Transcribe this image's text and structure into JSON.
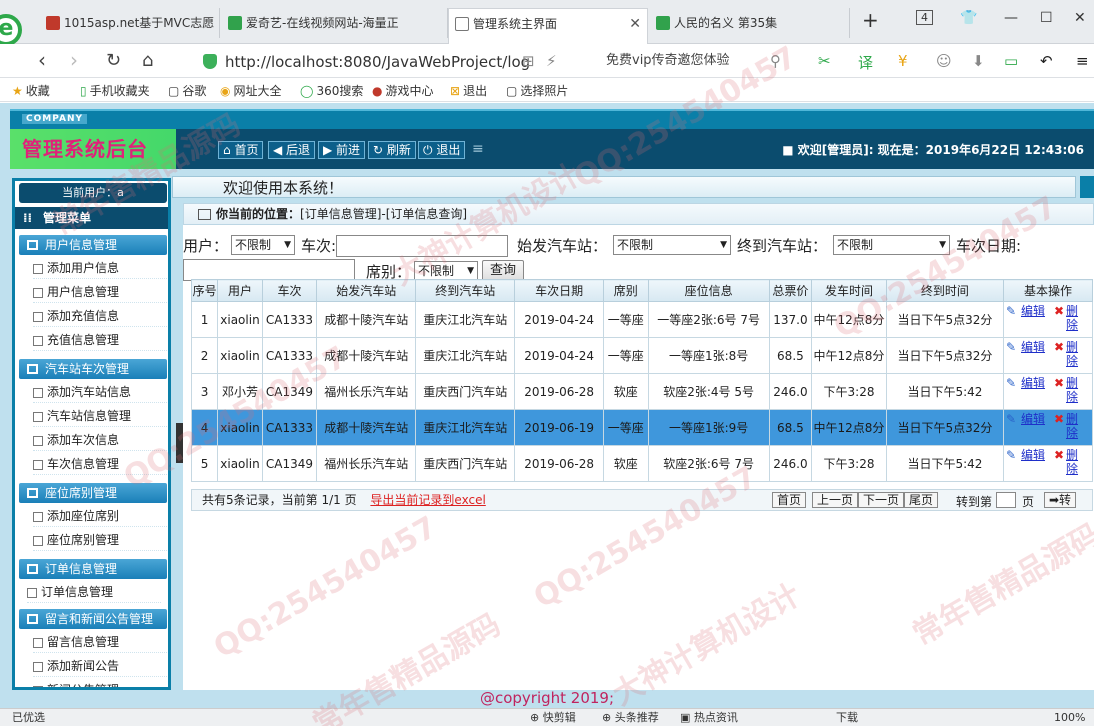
{
  "browser": {
    "tabs": [
      {
        "title": "1015asp.net基于MVC志愿"
      },
      {
        "title": "爱奇艺-在线视频网站-海量正"
      },
      {
        "title": "管理系统主界面"
      },
      {
        "title": "人民的名义 第35集"
      }
    ],
    "tab_count": "4",
    "url": "http://localhost:8080/JavaWebProject/log",
    "search_text": "免费vip传奇邀您体验",
    "bookmarks": [
      "收藏",
      "手机收藏夹",
      "谷歌",
      "网址大全",
      "360搜索",
      "游戏中心",
      "退出",
      "选择照片"
    ],
    "status_left": "已优选",
    "status_items": [
      "快剪辑",
      "头条推荐",
      "热点资讯",
      "下载"
    ],
    "zoom": "100%"
  },
  "header": {
    "company": "COMPANY",
    "brand": "管理系统后台",
    "nav": [
      "首页",
      "后退",
      "前进",
      "刷新",
      "退出"
    ],
    "welcome": "欢迎[管理员]:  现在是：2019年6月22日 12:43:06",
    "greeting": "欢迎使用本系统！"
  },
  "sidebar": {
    "current_user": "当前用户：a",
    "menu_title": "管理菜单",
    "groups": [
      {
        "title": "用户信息管理",
        "items": [
          "添加用户信息",
          "用户信息管理",
          "添加充值信息",
          "充值信息管理"
        ]
      },
      {
        "title": "汽车站车次管理",
        "items": [
          "添加汽车站信息",
          "汽车站信息管理",
          "添加车次信息",
          "车次信息管理"
        ]
      },
      {
        "title": "座位席别管理",
        "items": [
          "添加座位席别",
          "座位席别管理"
        ]
      },
      {
        "title": "订单信息管理",
        "items": [
          "订单信息管理"
        ]
      },
      {
        "title": "留言和新闻公告管理",
        "items": [
          "留言信息管理",
          "添加新闻公告",
          "新闻公告管理"
        ]
      }
    ]
  },
  "breadcrumb": {
    "label": "你当前的位置：",
    "path": "[订单信息管理]-[订单信息查询]"
  },
  "filter": {
    "user_label": "用户：",
    "user_value": "不限制",
    "train_label": "车次:",
    "train_value": "",
    "start_label": "始发汽车站：",
    "start_value": "不限制",
    "end_label": "终到汽车站：",
    "end_value": "不限制",
    "date_label": "车次日期:",
    "seat_label": "席别：",
    "seat_value": "不限制",
    "query_button": "查询"
  },
  "table": {
    "columns": [
      "序号",
      "用户",
      "车次",
      "始发汽车站",
      "终到汽车站",
      "车次日期",
      "席别",
      "座位信息",
      "总票价",
      "发车时间",
      "终到时间",
      "基本操作"
    ],
    "rows": [
      [
        "1",
        "xiaolin",
        "CA1333",
        "成都十陵汽车站",
        "重庆江北汽车站",
        "2019-04-24",
        "一等座",
        "一等座2张:6号 7号",
        "137.0",
        "中午12点8分",
        "当日下午5点32分"
      ],
      [
        "2",
        "xiaolin",
        "CA1333",
        "成都十陵汽车站",
        "重庆江北汽车站",
        "2019-04-24",
        "一等座",
        "一等座1张:8号",
        "68.5",
        "中午12点8分",
        "当日下午5点32分"
      ],
      [
        "3",
        "邓小芳",
        "CA1349",
        "福州长乐汽车站",
        "重庆西门汽车站",
        "2019-06-28",
        "软座",
        "软座2张:4号 5号",
        "246.0",
        "下午3:28",
        "当日下午5:42"
      ],
      [
        "4",
        "xiaolin",
        "CA1333",
        "成都十陵汽车站",
        "重庆江北汽车站",
        "2019-06-19",
        "一等座",
        "一等座1张:9号",
        "68.5",
        "中午12点8分",
        "当日下午5点32分"
      ],
      [
        "5",
        "xiaolin",
        "CA1349",
        "福州长乐汽车站",
        "重庆西门汽车站",
        "2019-06-28",
        "软座",
        "软座2张:6号 7号",
        "246.0",
        "下午3:28",
        "当日下午5:42"
      ]
    ],
    "edit_label": "编辑",
    "delete_label": "删除",
    "highlight_row": 4
  },
  "pager": {
    "summary": "共有5条记录，当前第 1/1 页",
    "export": "导出当前记录到excel",
    "buttons": [
      "首页",
      "上一页",
      "下一页",
      "尾页"
    ],
    "goto_label": "转到第",
    "page_suffix": "页",
    "go_button": "➡转"
  },
  "footer": "@copyright 2019;",
  "watermarks": [
    "QQ:254540457",
    "大神计算机设计",
    "常年售精品源码"
  ]
}
